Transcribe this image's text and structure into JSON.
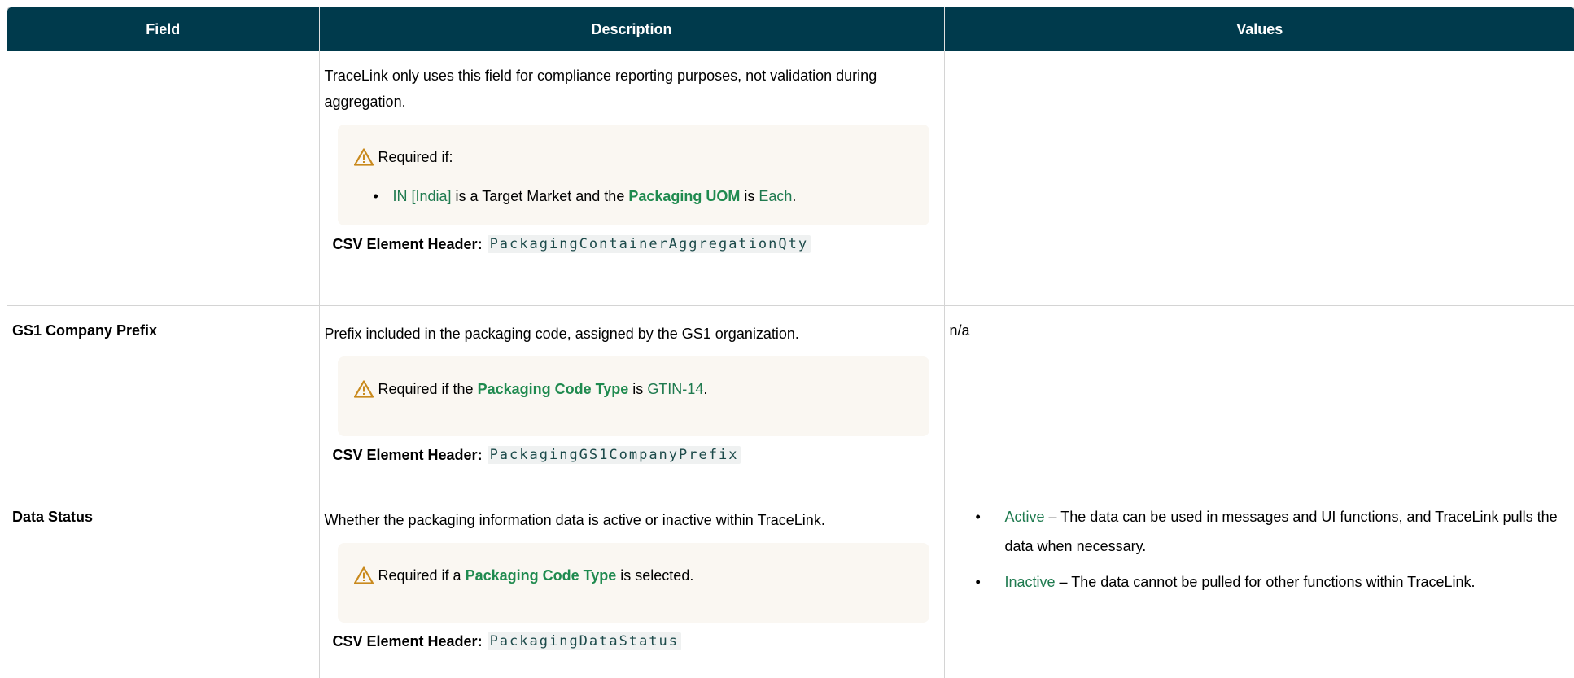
{
  "headers": {
    "field": "Field",
    "description": "Description",
    "values": "Values"
  },
  "rows": [
    {
      "field": "",
      "description": "TraceLink only uses this field for compliance reporting purposes, not validation during aggregation.",
      "note": {
        "lead": "Required if:",
        "bullet": {
          "market": "IN [India]",
          "mid": " is a Target Market and the ",
          "term": "Packaging UOM",
          "is": " is ",
          "value": "Each",
          "end": "."
        }
      },
      "csv_label": "CSV Element Header:",
      "csv_code": "PackagingContainerAggregationQty",
      "values": ""
    },
    {
      "field": "GS1 Company Prefix",
      "description": "Prefix included in the packaging code, assigned by the GS1 organization.",
      "note": {
        "lead": "Required if the ",
        "term": "Packaging Code Type",
        "is": " is ",
        "value": "GTIN-14",
        "end": "."
      },
      "csv_label": "CSV Element Header:",
      "csv_code": "PackagingGS1CompanyPrefix",
      "values": "n/a"
    },
    {
      "field": "Data Status",
      "description": "Whether the packaging information data is active or inactive within TraceLink.",
      "note": {
        "lead": "Required if a ",
        "term": "Packaging Code Type",
        "end": " is selected."
      },
      "csv_label": "CSV Element Header:",
      "csv_code": "PackagingDataStatus",
      "values_list": [
        {
          "term": "Active",
          "text": " – The data can be used in messages and UI functions, and TraceLink pulls the data when necessary."
        },
        {
          "term": "Inactive",
          "text": " – The data cannot be pulled for other functions within TraceLink."
        }
      ]
    }
  ],
  "colors": {
    "header_bg": "#003a4c",
    "accent_green": "#1f8a4f",
    "note_bg": "#faf7f2",
    "warning": "#c98a1e"
  },
  "icons": {
    "warning": "warning-triangle-icon"
  }
}
